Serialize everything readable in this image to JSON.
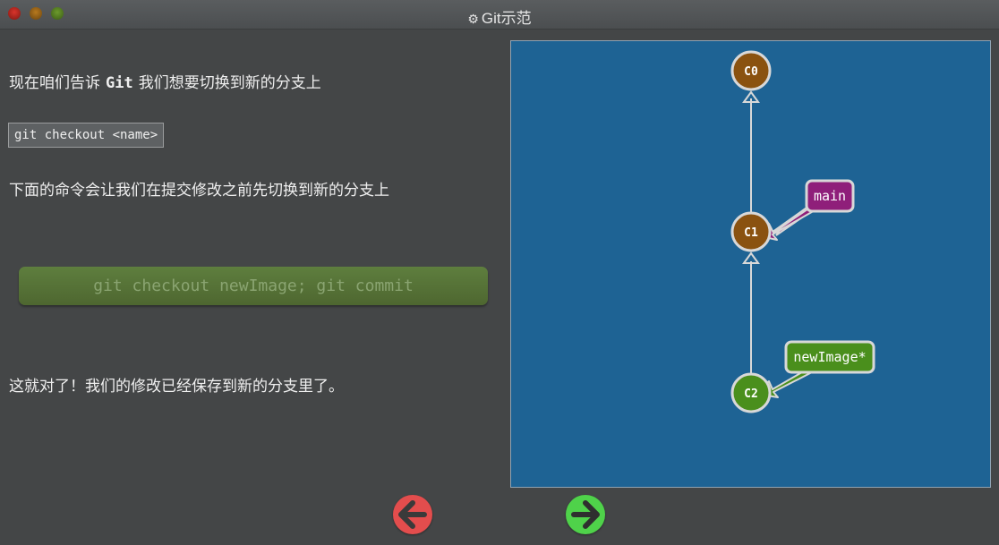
{
  "window": {
    "title": "Git示范",
    "title_icon": "gear-icon"
  },
  "lesson": {
    "intro_before": "现在咱们告诉",
    "intro_keyword": "Git",
    "intro_after": "我们想要切换到新的分支上",
    "syntax": "git checkout <name>",
    "explain": "下面的命令会让我们在提交修改之前先切换到新的分支上",
    "command": "git checkout newImage; git commit",
    "result": "这就对了！我们的修改已经保存到新的分支里了。"
  },
  "graph": {
    "commits": [
      {
        "id": "C0",
        "color": "#8a5210"
      },
      {
        "id": "C1",
        "color": "#8a5210"
      },
      {
        "id": "C2",
        "color": "#4a8f1c"
      }
    ],
    "branches": [
      {
        "label": "main",
        "target": "C1",
        "color": "#8f1f7a"
      },
      {
        "label": "newImage*",
        "target": "C2",
        "color": "#4a8f1c"
      }
    ]
  },
  "nav": {
    "prev_icon": "arrow-left-icon",
    "next_icon": "arrow-right-icon",
    "prev_color": "#e34d4d",
    "next_color": "#4fd24a"
  }
}
